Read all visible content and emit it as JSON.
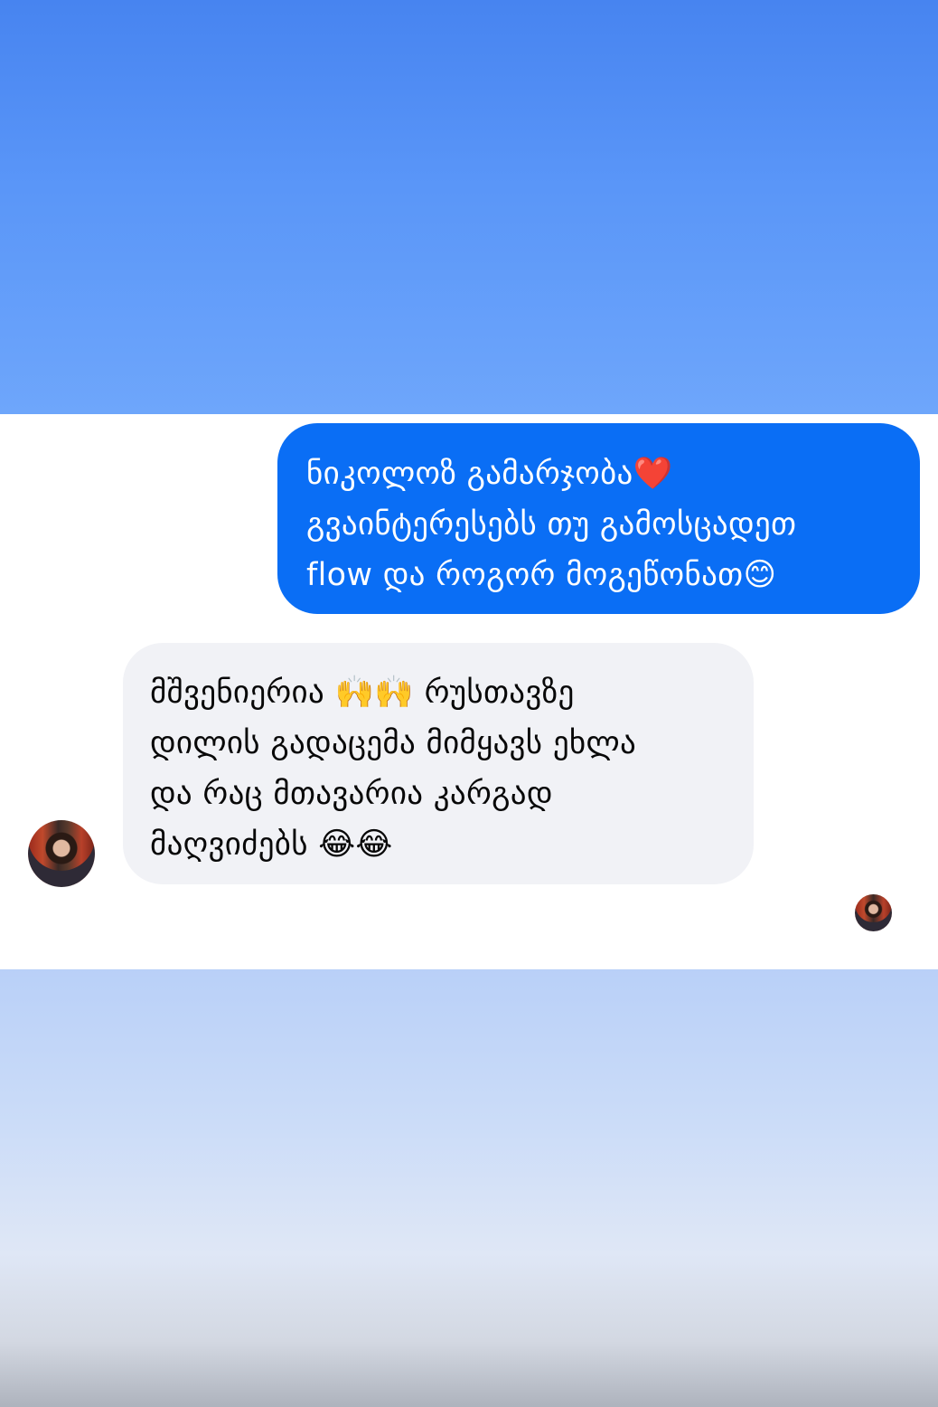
{
  "messages": {
    "outgoing": {
      "lines": [
        "ნიკოლოზ გამარჯობა❤️",
        "გვაინტერესებს თუ გამოსცადეთ",
        "flow და როგორ მოგეწონათ😊"
      ]
    },
    "incoming": {
      "lines": [
        "მშვენიერია 🙌🙌 რუსთავზე",
        "დილის გადაცემა მიმყავს ეხლა",
        "და რაც მთავარია კარგად",
        "მაღვიძებს 😂😂"
      ]
    }
  },
  "colors": {
    "outgoing_bubble": "#0a6ef5",
    "incoming_bubble": "#f1f2f6",
    "top_background": "#4784f0",
    "bottom_background": "#c9dbf8"
  },
  "icons": {
    "sender_avatar": "user-avatar-icon",
    "read_receipt": "seen-avatar-icon"
  }
}
